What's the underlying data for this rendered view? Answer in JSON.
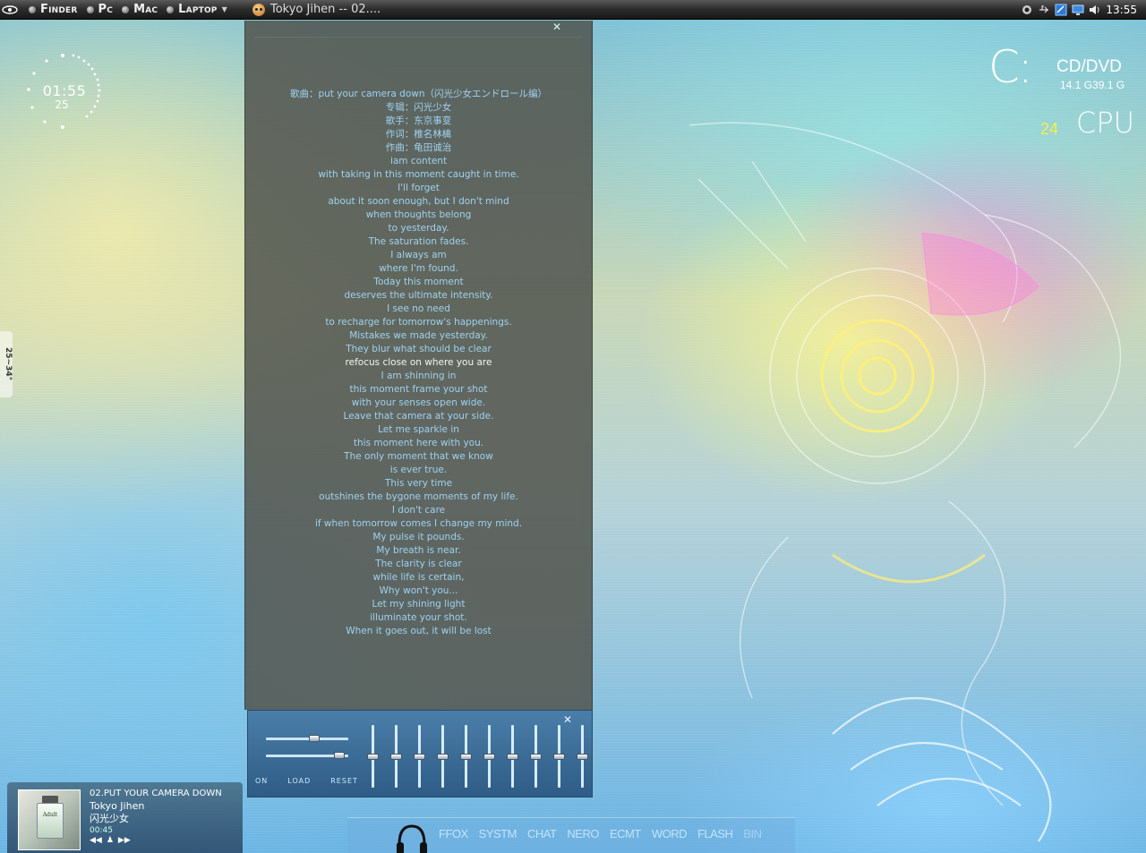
{
  "menubar": {
    "items": [
      "Finder",
      "Pc",
      "Mac",
      "Laptop"
    ],
    "now_playing_title": "Tokyo Jihen -- 02....",
    "clock": "13:55"
  },
  "clock_widget": {
    "time": "01:55",
    "seconds": "25"
  },
  "edge_tab": {
    "label": "25~34°"
  },
  "drive_widget": {
    "letter": "C:",
    "label": "CD/DVD",
    "sizes": "14.1 G39.1 G",
    "cpu_value": "24",
    "cpu_label": "CPU"
  },
  "lyrics": {
    "current_index": 14,
    "lines": [
      "歌曲：put your camera down（闪光少女エンドロール编）",
      "专辑：闪光少女",
      "歌手：东京事变",
      "作词：椎名林檎",
      "作曲：龟田诚治",
      "iam content",
      "with taking in this moment caught in time.",
      "I'll forget",
      "about it soon enough, but I don't mind",
      "when thoughts belong",
      "to yesterday.",
      "The saturation fades.",
      "I always am",
      "where I'm found.",
      "Today this moment",
      "deserves the ultimate intensity.",
      "I see no need",
      "to recharge for tomorrow's happenings.",
      "Mistakes we made yesterday.",
      "They blur what should be clear",
      "refocus close on where you are",
      "I am shinning in",
      "this moment frame your shot",
      "with your senses open wide.",
      "Leave that camera at your side.",
      "Let me sparkle in",
      "this moment here with you.",
      "The only moment that we know",
      "is ever true.",
      "This very time",
      "outshines the bygone moments of my life.",
      "I don't care",
      "if when tomorrow comes I change my mind.",
      "My pulse it pounds.",
      "My breath is near.",
      "The clarity is clear",
      "while life is certain,",
      "Why won't you...",
      "Let my shining light",
      "illuminate your shot.",
      "When it goes out, it will be lost"
    ]
  },
  "equalizer": {
    "buttons": [
      "ON",
      "LOAD",
      "RESET"
    ],
    "bands": [
      0.5,
      0.5,
      0.5,
      0.5,
      0.5,
      0.5,
      0.5,
      0.5,
      0.5,
      0.5
    ],
    "preamp": 0.6,
    "balance": 0.95
  },
  "now_playing": {
    "track": "02.PUT YOUR CAMERA DOWN",
    "artist": "Tokyo Jihen",
    "album": "闪光少女",
    "elapsed": "00:45",
    "cover_text": "Adult",
    "controls": [
      "◀◀",
      "♟",
      "▶▶"
    ]
  },
  "dock": {
    "items": [
      "FFOX",
      "SYSTM",
      "CHAT",
      "NERO",
      "ECMT",
      "WORD",
      "FLASH",
      "BIN"
    ]
  },
  "colors": {
    "lyric_text": "#9ed2f0",
    "lyric_current": "#f4f4f4",
    "cpu_accent": "#f2f04a"
  }
}
